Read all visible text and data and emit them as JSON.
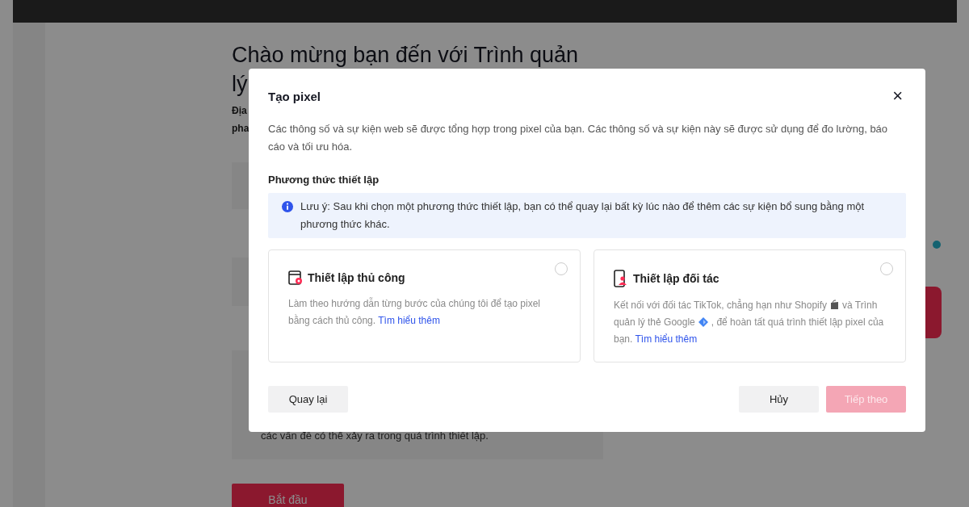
{
  "background": {
    "heading_lines": [
      "Chào mừng bạn đến với Trình quản",
      "lý"
    ],
    "intro_lines": [
      "Địa",
      "pha"
    ],
    "card_text": "các vấn đề có thể xảy ra trong quá trình thiết lập.",
    "start_button": "Bắt đầu"
  },
  "modal": {
    "title": "Tạo pixel",
    "close": "×",
    "description": "Các thông số và sự kiện web sẽ được tổng hợp trong pixel của bạn. Các thông số và sự kiện này sẽ được sử dụng để đo lường, báo cáo và tối ưu hóa.",
    "section_label": "Phương thức thiết lập",
    "note": "Lưu ý: Sau khi chọn một phương thức thiết lập, bạn có thể quay lại bất kỳ lúc nào để thêm các sự kiện bổ sung bằng một phương thức khác.",
    "options": [
      {
        "kind": "manual",
        "title": "Thiết lập thủ công",
        "segments": [
          "Làm theo hướng dẫn từng bước của chúng tôi để tạo pixel bằng cách thủ công."
        ],
        "link": "Tìm hiểu thêm",
        "selected": false
      },
      {
        "kind": "partner",
        "title": "Thiết lập đối tác",
        "segments": [
          "Kết nối với đối tác TikTok, chẳng hạn như Shopify",
          "và Trình quản lý thẻ Google",
          ", để hoàn tất quá trình thiết lập pixel của bạn."
        ],
        "link": "Tìm hiểu thêm",
        "selected": false
      }
    ],
    "back_button": "Quay lại",
    "cancel_button": "Hủy",
    "next_button": {
      "label": "Tiếp theo",
      "disabled": true
    }
  }
}
